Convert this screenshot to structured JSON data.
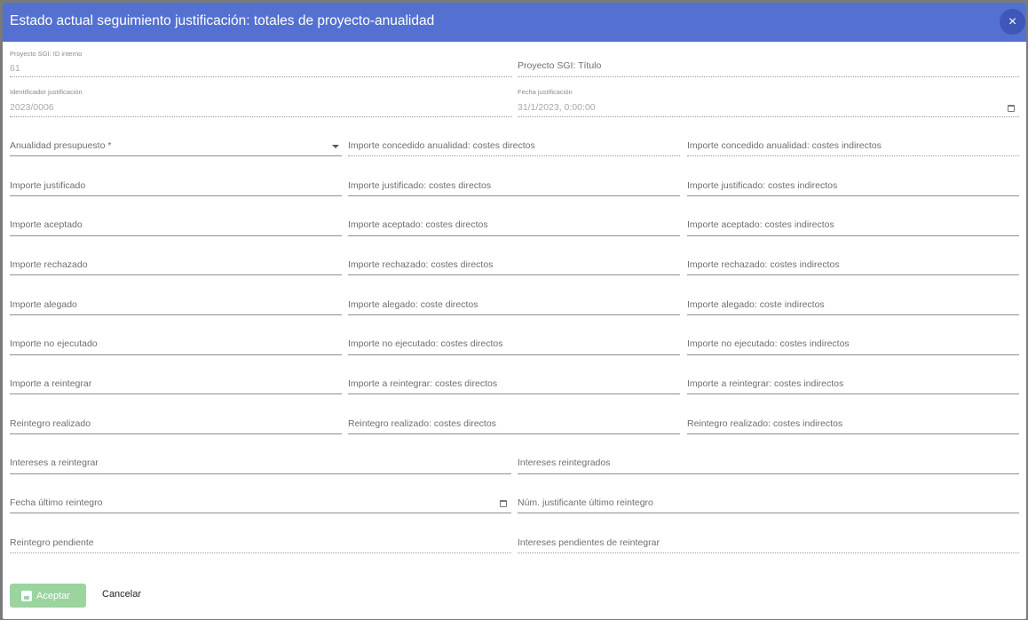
{
  "dialog": {
    "title": "Estado actual seguimiento justificación: totales de proyecto-anualidad",
    "close_icon": "×"
  },
  "fields": {
    "proyecto_id": {
      "label": "Proyecto SGI: ID interno",
      "value": "61"
    },
    "proyecto_titulo": {
      "label": "Proyecto SGI: Título"
    },
    "identificador": {
      "label": "Identificador justificación",
      "value": "2023/0006"
    },
    "fecha_justificacion": {
      "label": "Fecha justificación",
      "value": "31/1/2023, 0:00:00"
    },
    "anualidad": {
      "label": "Anualidad presupuesto *"
    },
    "concedido_directos": {
      "label": "Importe concedido anualidad: costes directos"
    },
    "concedido_indirectos": {
      "label": "Importe concedido anualidad: costes indirectos"
    },
    "justificado": {
      "label": "Importe justificado"
    },
    "justificado_directos": {
      "label": "Importe justificado: costes directos"
    },
    "justificado_indirectos": {
      "label": "Importe justificado: costes indirectos"
    },
    "aceptado": {
      "label": "Importe aceptado"
    },
    "aceptado_directos": {
      "label": "Importe aceptado: costes directos"
    },
    "aceptado_indirectos": {
      "label": "Importe aceptado: costes indirectos"
    },
    "rechazado": {
      "label": "Importe rechazado"
    },
    "rechazado_directos": {
      "label": "Importe rechazado: costes directos"
    },
    "rechazado_indirectos": {
      "label": "Importe rechazado: costes indirectos"
    },
    "alegado": {
      "label": "Importe alegado"
    },
    "alegado_directos": {
      "label": "Importe alegado: coste directos"
    },
    "alegado_indirectos": {
      "label": "Importe alegado: coste indirectos"
    },
    "no_ejecutado": {
      "label": "Importe no ejecutado"
    },
    "no_ejecutado_directos": {
      "label": "Importe no ejecutado: costes directos"
    },
    "no_ejecutado_indirectos": {
      "label": "Importe no ejecutado: costes indirectos"
    },
    "reintegrar": {
      "label": "Importe a reintegrar"
    },
    "reintegrar_directos": {
      "label": "Importe a reintegrar: costes directos"
    },
    "reintegrar_indirectos": {
      "label": "Importe a reintegrar: costes indirectos"
    },
    "reintegro_realizado": {
      "label": "Reintegro realizado"
    },
    "reintegro_directos": {
      "label": "Reintegro realizado: costes directos"
    },
    "reintegro_indirectos": {
      "label": "Reintegro realizado: costes indirectos"
    },
    "intereses_reintegrar": {
      "label": "Intereses a reintegrar"
    },
    "intereses_reintegrados": {
      "label": "Intereses reintegrados"
    },
    "fecha_ultimo_reintegro": {
      "label": "Fecha último reintegro"
    },
    "num_justificante": {
      "label": "Núm. justificante último reintegro"
    },
    "reintegro_pendiente": {
      "label": "Reintegro pendiente"
    },
    "intereses_pendientes": {
      "label": "Intereses pendientes de reintegrar"
    }
  },
  "actions": {
    "accept_label": "Aceptar",
    "cancel_label": "Cancelar"
  },
  "colors": {
    "header": "#5470d0",
    "accept_button": "#9bd49f"
  }
}
